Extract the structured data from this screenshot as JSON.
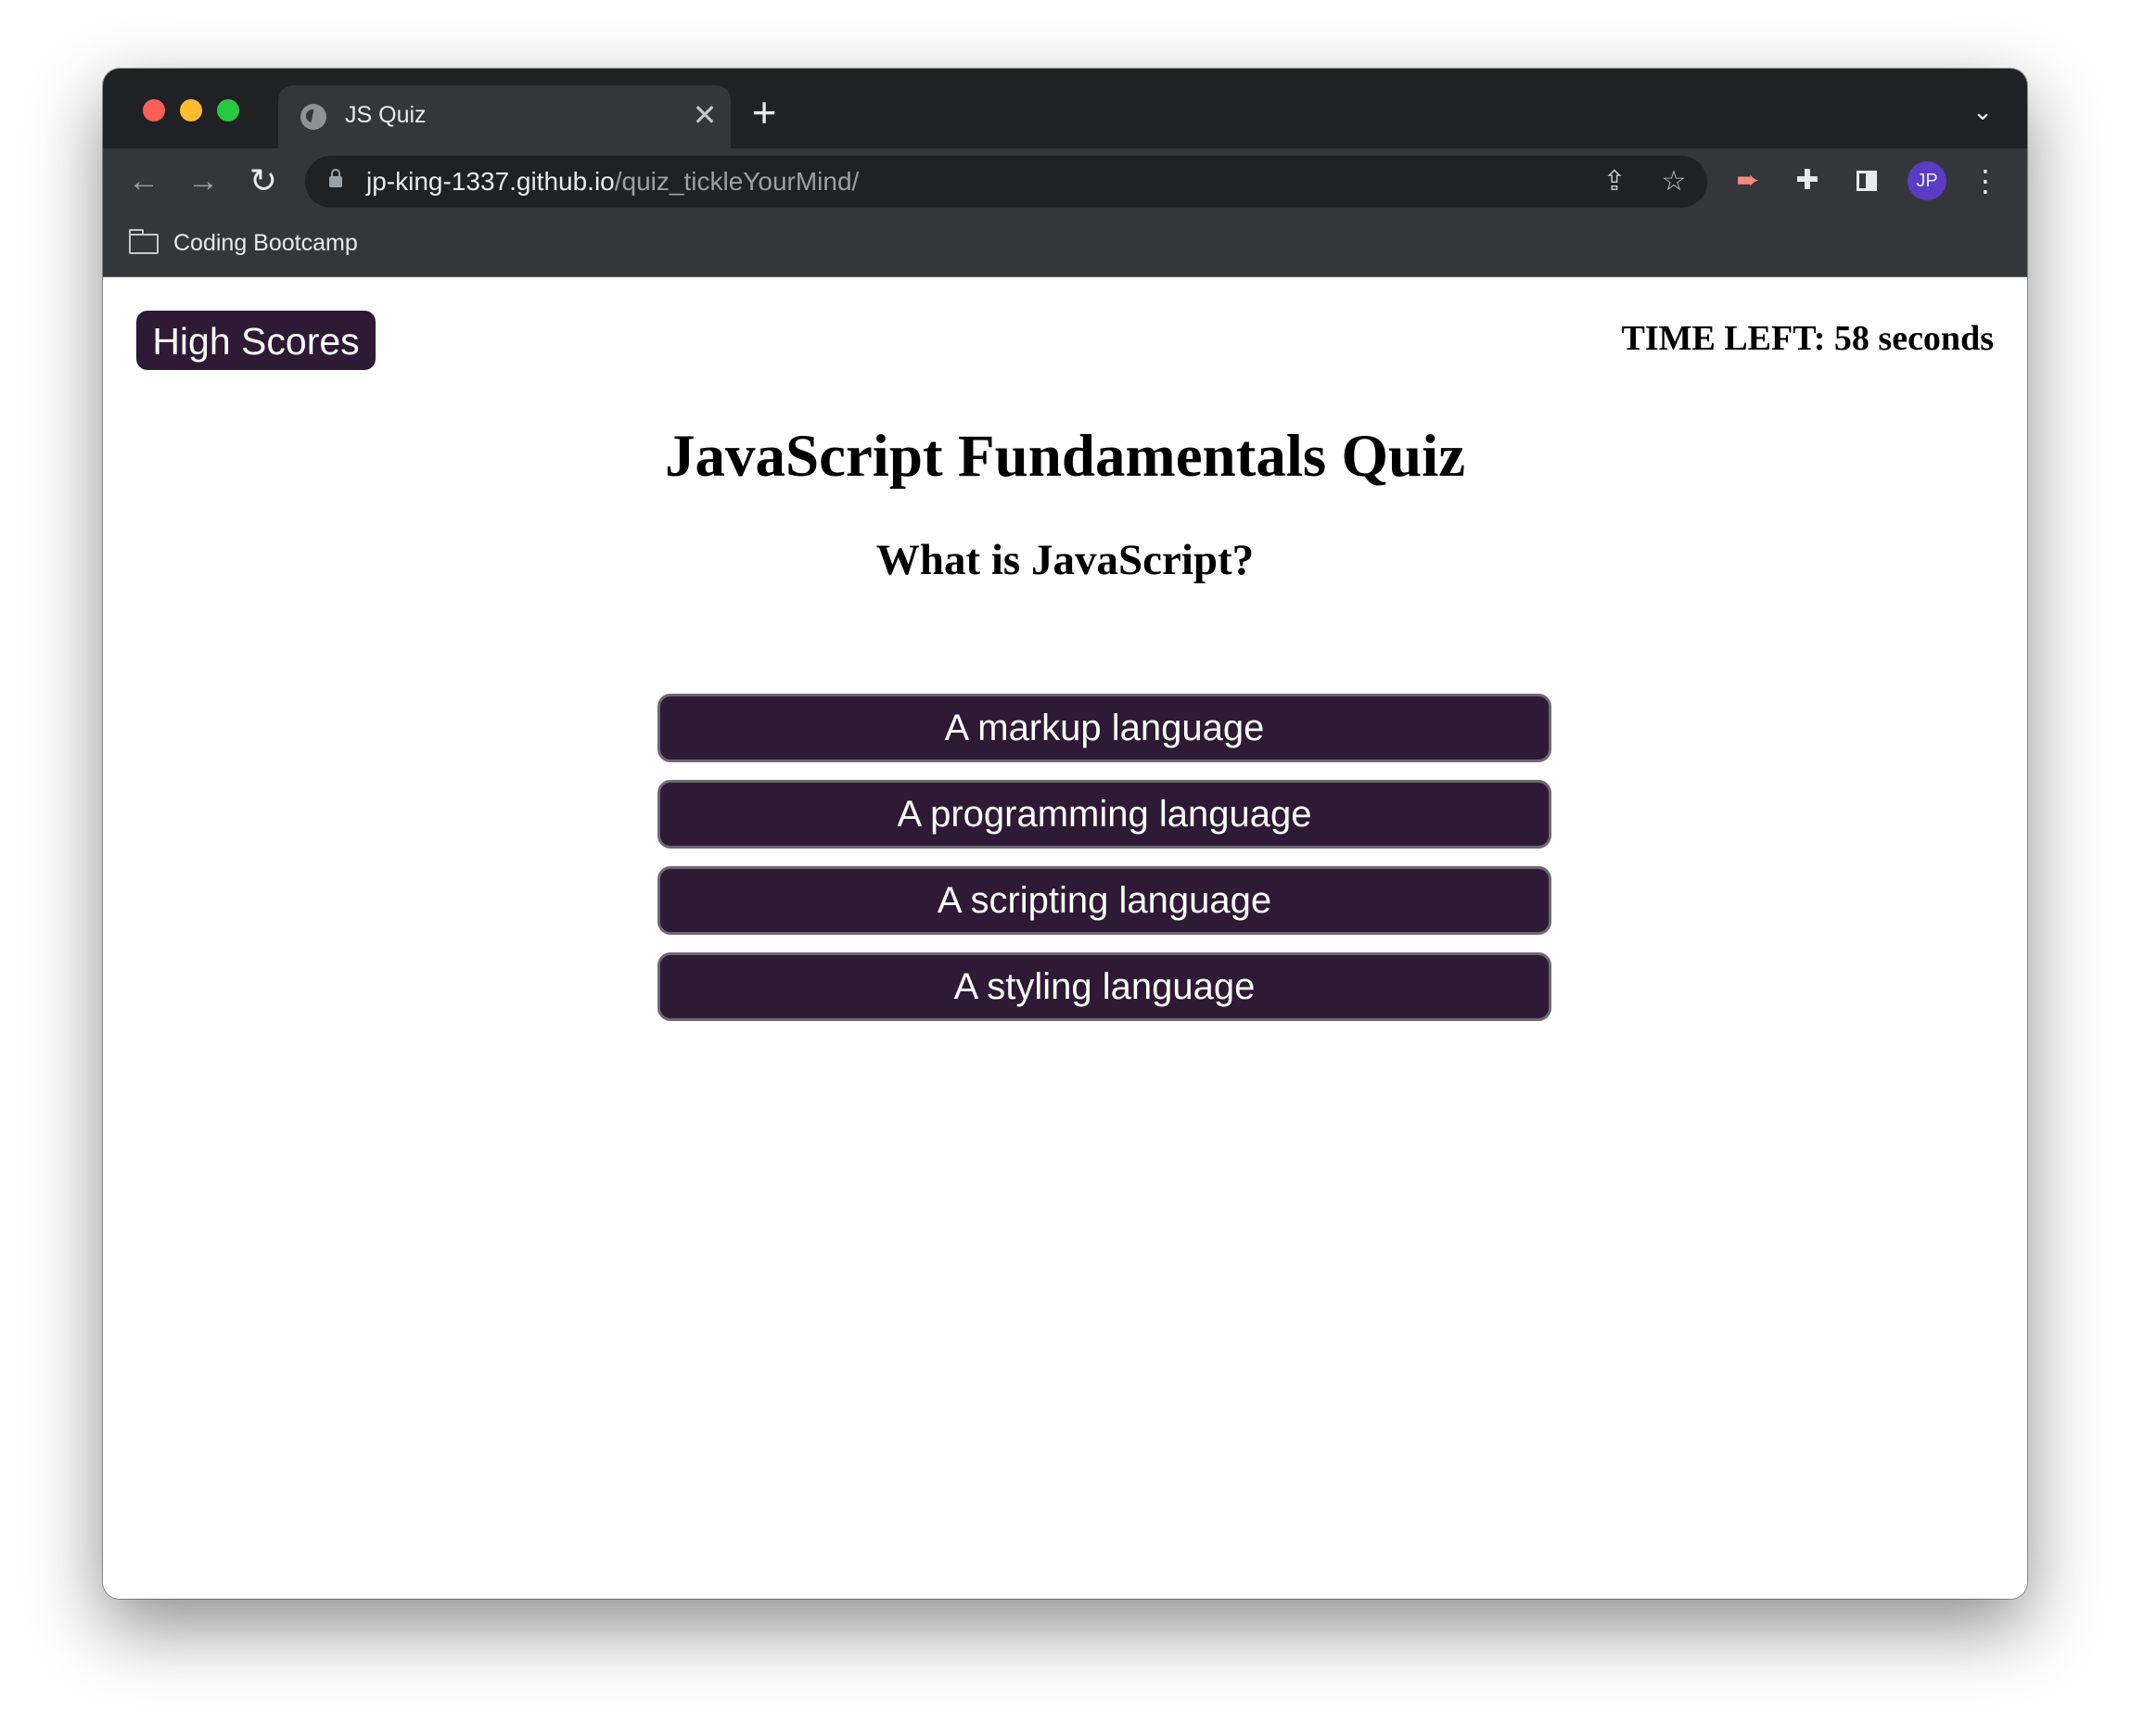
{
  "browser": {
    "tab_title": "JS Quiz",
    "tab_close": "✕",
    "new_tab": "+",
    "url_host": "jp-king-1337.github.io",
    "url_path": "/quiz_tickleYourMind/",
    "profile_initials": "JP",
    "bookmarks": [
      {
        "label": "Coding Bootcamp"
      }
    ]
  },
  "page": {
    "high_scores_label": "High Scores",
    "timer_text": "TIME LEFT: 58 seconds",
    "quiz_title": "JavaScript Fundamentals Quiz",
    "question": "What is JavaScript?",
    "answers": [
      {
        "label": "A markup language"
      },
      {
        "label": "A programming language"
      },
      {
        "label": "A scripting language"
      },
      {
        "label": "A styling language"
      }
    ]
  },
  "colors": {
    "button_bg": "#2e1a34",
    "chrome_dark": "#202124",
    "chrome_toolbar": "#35363a"
  }
}
